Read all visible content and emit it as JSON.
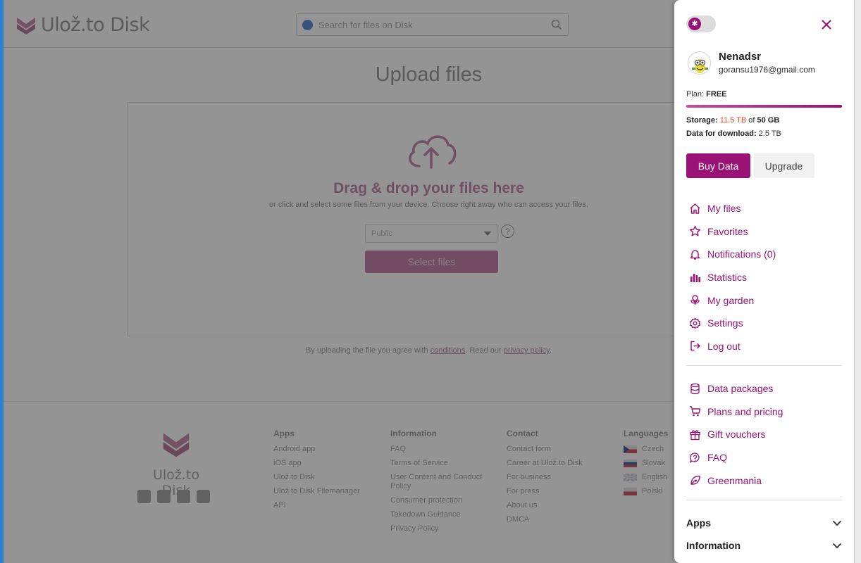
{
  "background": {
    "logo_text": "Ulož.to Disk",
    "search_placeholder": "Search for files on Disk",
    "upload_title": "Upload files",
    "drag_title": "Drag & drop your files here",
    "drag_subtitle": "or click and select some files from your device. Choose right away who can access your files.",
    "access_value": "Public",
    "help_glyph": "?",
    "select_files_label": "Select files",
    "terms_prefix": "By uploading the file you agree with",
    "terms_link": "conditions",
    "terms_middle": ". Read our",
    "privacy_link": "privacy policy",
    "terms_suffix": ".",
    "footer": {
      "logo_text": "Ulož.to Disk",
      "apps": {
        "heading": "Apps",
        "items": [
          "Android app",
          "iOS app",
          "Ulož.to Disk",
          "Ulož.to Disk Filemanager",
          "API"
        ]
      },
      "information": {
        "heading": "Information",
        "items": [
          "FAQ",
          "Terms of Service",
          "User Content and Conduct Policy",
          "Consumer protection",
          "Takedown Guidance",
          "Privacy Policy"
        ]
      },
      "contact": {
        "heading": "Contact",
        "items": [
          "Contact form",
          "Career at Ulož.to Disk",
          "For business",
          "For press",
          "About us",
          "DMCA"
        ]
      },
      "languages": {
        "heading": "Languages",
        "items": [
          "Czech",
          "Slovak",
          "English",
          "Polski"
        ]
      }
    }
  },
  "panel": {
    "theme_toggle_glyph": "✱",
    "user": {
      "name": "Nenadsr",
      "email": "goransu1976@gmail.com"
    },
    "plan_label": "Plan:",
    "plan_value": "FREE",
    "storage_label": "Storage:",
    "storage_used": "11.5 TB",
    "storage_of": "of",
    "storage_total": "50 GB",
    "storage_progress": 1.0,
    "download_label": "Data for download:",
    "download_value": "2.5 TB",
    "buy_data_label": "Buy Data",
    "upgrade_label": "Upgrade",
    "menu_main": [
      {
        "label": "My files",
        "icon": "home-icon"
      },
      {
        "label": "Favorites",
        "icon": "star-icon"
      },
      {
        "label": "Notifications (0)",
        "icon": "bell-icon"
      },
      {
        "label": "Statistics",
        "icon": "bar-chart-icon"
      },
      {
        "label": "My garden",
        "icon": "flower-icon"
      },
      {
        "label": "Settings",
        "icon": "gear-icon"
      },
      {
        "label": "Log out",
        "icon": "logout-icon"
      }
    ],
    "menu_secondary": [
      {
        "label": "Data packages",
        "icon": "database-icon"
      },
      {
        "label": "Plans and pricing",
        "icon": "cart-icon"
      },
      {
        "label": "Gift vouchers",
        "icon": "gift-icon"
      },
      {
        "label": "FAQ",
        "icon": "help-bubble-icon"
      },
      {
        "label": "Greenmania",
        "icon": "leaf-icon"
      }
    ],
    "accordions": [
      {
        "label": "Apps"
      },
      {
        "label": "Information"
      }
    ],
    "colors": {
      "accent": "#9a1276",
      "storage_used": "#e4462e"
    }
  }
}
